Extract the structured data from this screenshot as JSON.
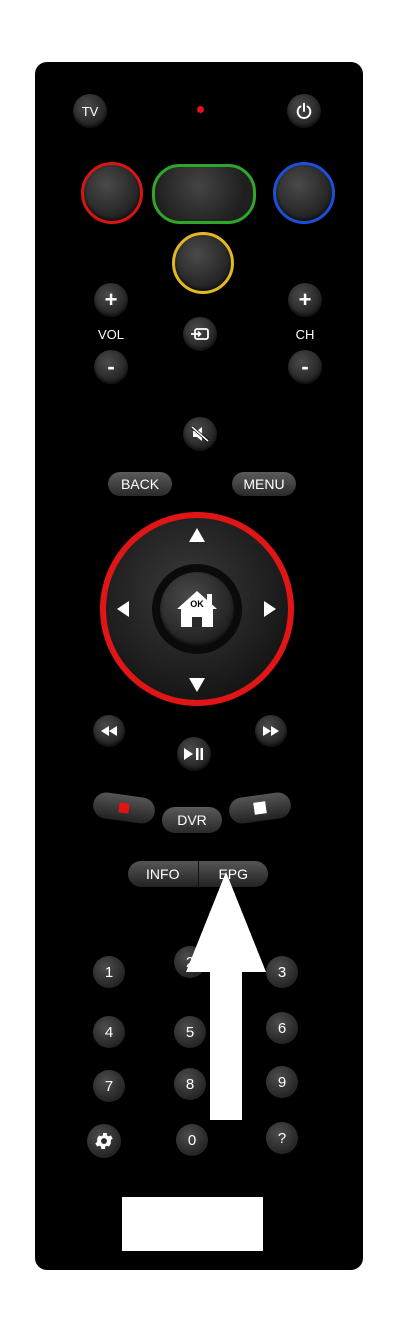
{
  "remote": {
    "tv_label": "TV",
    "vol_label": "VOL",
    "ch_label": "CH",
    "plus": "+",
    "minus": "-",
    "back_label": "BACK",
    "menu_label": "MENU",
    "ok_label": "OK",
    "dvr_label": "DVR",
    "info_label": "INFO",
    "epg_label": "EPG",
    "numbers": [
      "1",
      "2",
      "3",
      "4",
      "5",
      "6",
      "7",
      "8",
      "9",
      "0"
    ],
    "help_label": "?"
  },
  "colors": {
    "red": "#d81414",
    "green": "#2fa52a",
    "blue": "#1c4fd8",
    "yellow": "#e1b822",
    "dpad_ring": "#e01515"
  }
}
